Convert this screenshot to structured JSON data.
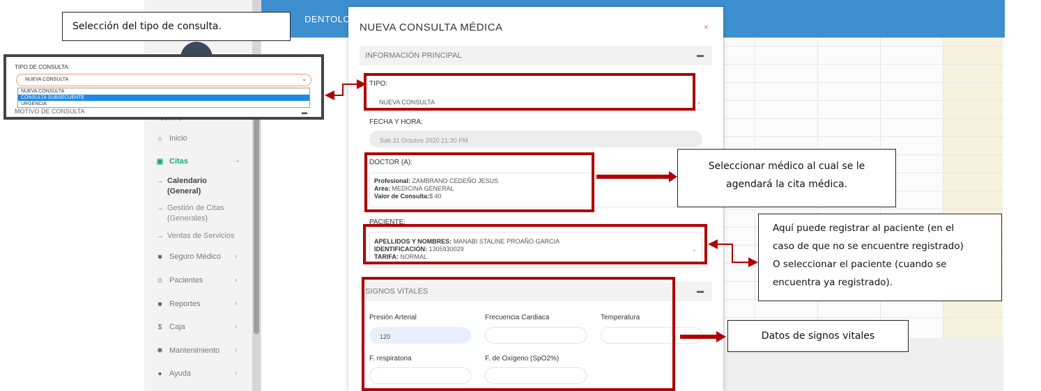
{
  "app": {
    "brand": "DENTOLO",
    "sidebar": {
      "heading": "Archivo",
      "items": [
        {
          "icon": "home-icon",
          "glyph": "⌂",
          "label": "Inicio",
          "active": false
        },
        {
          "icon": "calendar-icon",
          "glyph": "▣",
          "label": "Citas",
          "active": true
        },
        {
          "icon": "briefcase-icon",
          "glyph": "■",
          "label": "Seguro Médico",
          "active": false
        },
        {
          "icon": "users-icon",
          "glyph": "☺",
          "label": "Pacientes",
          "active": false
        },
        {
          "icon": "folder-icon",
          "glyph": "■",
          "label": "Reportes",
          "active": false
        },
        {
          "icon": "dollar-icon",
          "glyph": "$",
          "label": "Caja",
          "active": false
        },
        {
          "icon": "gear-icon",
          "glyph": "✱",
          "label": "Mantenimiento",
          "active": false
        },
        {
          "icon": "help-icon",
          "glyph": "●",
          "label": "Ayuda",
          "active": false
        }
      ],
      "sub_items": [
        {
          "label_1": "Calendario",
          "label_2": "(General)",
          "strong": true
        },
        {
          "label_1": "Gestión de Citas",
          "label_2": "(Generales)",
          "strong": false
        },
        {
          "label_1": "Ventas de Servicios",
          "label_2": "",
          "strong": false
        }
      ],
      "dash": "→",
      "chevron_down": "⌄",
      "chevron_right": "›"
    }
  },
  "modal": {
    "title": "NUEVA CONSULTA MÉDICA",
    "close": "×",
    "section_main": "INFORMACIÓN PRINCIPAL",
    "section_vitals": "SIGNOS VITALES",
    "comment_glyph": "▬",
    "tipo_label": "TIPO:",
    "tipo_value": "NUEVA CONSULTA",
    "fecha_label": "FECHA Y HORA:",
    "fecha_value": "Sab 31 Octubre 2020 21:30 PM",
    "doctor_label": "DOCTOR (A):",
    "doctor": {
      "profesional_key": "Profesional:",
      "profesional_val": " ZAMBRANO CEDEÑO JESUS",
      "area_key": "Area:",
      "area_val": " MEDICINA GENERAL",
      "valor_key": "Valor de Consulta:",
      "valor_val": "$ 40"
    },
    "paciente_label": "PACIENTE:",
    "paciente": {
      "nombres_key": "APELLIDOS Y NOMBRES:",
      "nombres_val": " MANABI STALINE PROAÑO GARCIA",
      "id_key": "IDENTIFICACIÓN:",
      "id_val": " 1305930029",
      "tarifa_key": "TARIFA:",
      "tarifa_val": " NORMAL"
    },
    "vitals": {
      "presion_label": "Presión Arterial",
      "presion_value": "120",
      "frecuencia_label": "Frecuencia Cardiaca",
      "temperatura_label": "Temperatura",
      "respiratoria_label": "F. respiratoria",
      "oxigeno_label": "F. de Oxígeno (SpO2%)"
    }
  },
  "inset": {
    "label": "TIPO DE CONSULTA:",
    "selected": "NUEVA CONSULTA",
    "options": [
      "NUEVA CONSULTA",
      "CONSULTA SUBSECUENTE",
      "URGENCIA"
    ],
    "highlighted_index": 1,
    "bg_text": "MOTIVO DE CONSULTA"
  },
  "callouts": {
    "tipo": "Selección del tipo de consulta.",
    "doctor_1": "Seleccionar médico al cual se le",
    "doctor_2": "agendará la cita médica.",
    "paciente_1": "Aquí puede registrar al paciente (en el",
    "paciente_2": "caso de que no se encuentre registrado)",
    "paciente_3": "O seleccionar el paciente (cuando se",
    "paciente_4": "encuentra ya registrado).",
    "vitales": "Datos de signos vitales"
  },
  "colors": {
    "annotation_red": "#b00000",
    "topbar_blue": "#3d8fcf",
    "active_green": "#19a974",
    "option_highlight": "#1e88e5"
  }
}
